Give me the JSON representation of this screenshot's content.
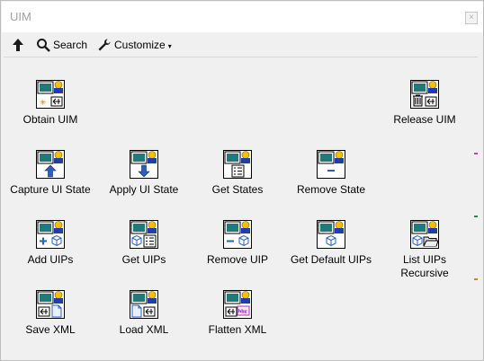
{
  "window": {
    "title": "UIM",
    "close_glyph": "×"
  },
  "toolbar": {
    "up_icon": "arrow-up-icon",
    "search_label": "Search",
    "customize_label": "Customize",
    "customize_caret": "▾"
  },
  "items": [
    {
      "label": "Obtain UIM",
      "icon": "obtain-icon"
    },
    {
      "label": "Release UIM",
      "icon": "release-icon"
    },
    {
      "label": "Capture UI State",
      "icon": "capture-icon"
    },
    {
      "label": "Apply UI State",
      "icon": "apply-icon"
    },
    {
      "label": "Get States",
      "icon": "list-icon"
    },
    {
      "label": "Remove State",
      "icon": "minus-icon"
    },
    {
      "label": "Add UIPs",
      "icon": "plus-cube-icon"
    },
    {
      "label": "Get UIPs",
      "icon": "cube-list-icon"
    },
    {
      "label": "Remove UIP",
      "icon": "minus-cube-icon"
    },
    {
      "label": "Get Default UIPs",
      "icon": "cube-icon"
    },
    {
      "label": "List UIPs",
      "label2": "Recursive",
      "icon": "cube-folder-icon"
    },
    {
      "label": "Save XML",
      "icon": "save-xml-icon"
    },
    {
      "label": "Load XML",
      "icon": "load-xml-icon"
    },
    {
      "label": "Flatten XML",
      "icon": "flatten-xml-icon"
    }
  ],
  "colors": {
    "accent_blue": "#2b5fb8",
    "window_bg": "#f0f0f0",
    "title_gray": "#a0a0a0"
  }
}
